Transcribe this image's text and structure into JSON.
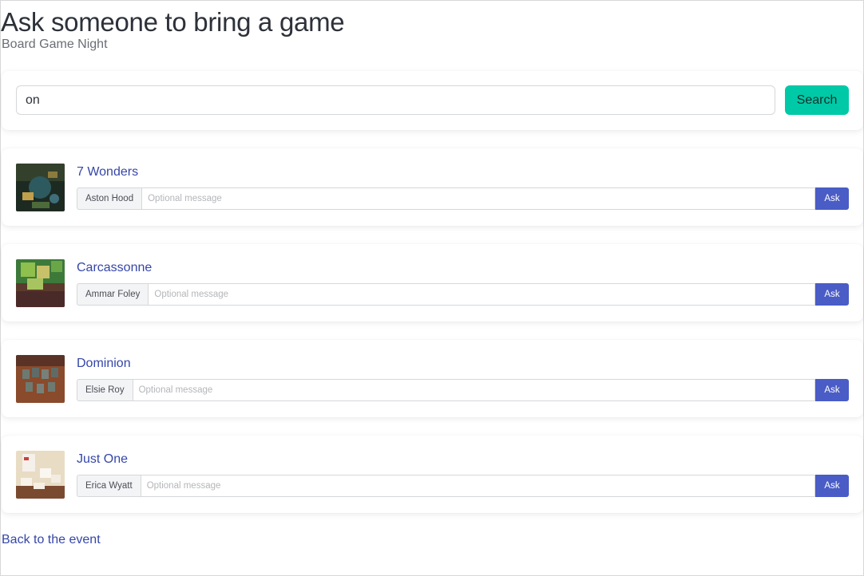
{
  "header": {
    "title": "Ask someone to bring a game",
    "subtitle": "Board Game Night"
  },
  "search": {
    "value": "on",
    "button_label": "Search"
  },
  "games": [
    {
      "title": "7 Wonders",
      "person": "Aston Hood",
      "message_placeholder": "Optional message",
      "ask_label": "Ask"
    },
    {
      "title": "Carcassonne",
      "person": "Ammar Foley",
      "message_placeholder": "Optional message",
      "ask_label": "Ask"
    },
    {
      "title": "Dominion",
      "person": "Elsie Roy",
      "message_placeholder": "Optional message",
      "ask_label": "Ask"
    },
    {
      "title": "Just One",
      "person": "Erica Wyatt",
      "message_placeholder": "Optional message",
      "ask_label": "Ask"
    }
  ],
  "footer": {
    "back_link": "Back to the event"
  },
  "colors": {
    "search_button": "#00c9a7",
    "ask_button": "#4a5cc6",
    "link": "#3546a8"
  }
}
